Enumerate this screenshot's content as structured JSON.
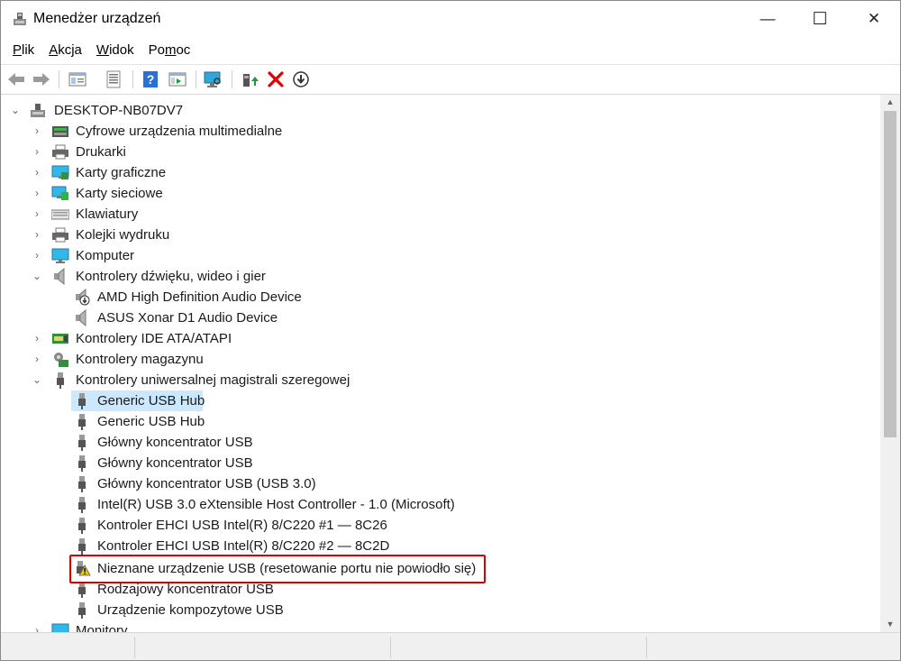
{
  "window": {
    "title": "Menedżer urządzeń",
    "app_icon": "device-manager-icon",
    "controls": {
      "minimize": "—",
      "maximize": "☐",
      "close": "✕"
    }
  },
  "menubar": {
    "items": [
      {
        "label": "Plik",
        "underline": "P"
      },
      {
        "label": "Akcja",
        "underline": "A"
      },
      {
        "label": "Widok",
        "underline": "W"
      },
      {
        "label": "Pomoc",
        "underline": "m"
      }
    ]
  },
  "toolbar": {
    "buttons": [
      "back-arrow-icon",
      "forward-arrow-icon",
      "properties-pane-icon",
      "device-list-icon",
      "help-icon",
      "show-hide-tree-icon",
      "scan-hardware-icon",
      "update-driver-icon",
      "uninstall-x-icon",
      "disable-device-icon"
    ],
    "colors": {
      "help": "#2a6fd6",
      "uninstall": "#e00000",
      "update": "#1a9b3a"
    }
  },
  "tree": {
    "root": "DESKTOP-NB07DV7",
    "nodes": [
      {
        "label": "Cyfrowe urządzenia multimedialne",
        "icon": "multimedia-device-icon",
        "expanded": false
      },
      {
        "label": "Drukarki",
        "icon": "printer-icon",
        "expanded": false
      },
      {
        "label": "Karty graficzne",
        "icon": "display-adapter-icon",
        "expanded": false
      },
      {
        "label": "Karty sieciowe",
        "icon": "network-adapter-icon",
        "expanded": false
      },
      {
        "label": "Klawiatury",
        "icon": "keyboard-icon",
        "expanded": false
      },
      {
        "label": "Kolejki wydruku",
        "icon": "print-queue-icon",
        "expanded": false
      },
      {
        "label": "Komputer",
        "icon": "computer-icon",
        "expanded": false
      },
      {
        "label": "Kontrolery dźwięku, wideo i gier",
        "icon": "speaker-icon",
        "expanded": true,
        "children": [
          {
            "label": "AMD High Definition Audio Device",
            "icon": "audio-device-disabled-icon"
          },
          {
            "label": "ASUS Xonar D1 Audio Device",
            "icon": "speaker-icon"
          }
        ]
      },
      {
        "label": "Kontrolery IDE ATA/ATAPI",
        "icon": "ide-controller-icon",
        "expanded": false
      },
      {
        "label": "Kontrolery magazynu",
        "icon": "storage-controller-icon",
        "expanded": false
      },
      {
        "label": "Kontrolery uniwersalnej magistrali szeregowej",
        "icon": "usb-plug-icon",
        "expanded": true,
        "children": [
          {
            "label": "Generic USB Hub",
            "icon": "usb-plug-icon",
            "selected": true
          },
          {
            "label": "Generic USB Hub",
            "icon": "usb-plug-icon"
          },
          {
            "label": "Główny koncentrator USB",
            "icon": "usb-plug-icon"
          },
          {
            "label": "Główny koncentrator USB",
            "icon": "usb-plug-icon"
          },
          {
            "label": "Główny koncentrator USB (USB 3.0)",
            "icon": "usb-plug-icon"
          },
          {
            "label": "Intel(R) USB 3.0 eXtensible Host Controller - 1.0 (Microsoft)",
            "icon": "usb-plug-icon"
          },
          {
            "label": "Kontroler EHCI USB Intel(R) 8/C220 #1 — 8C26",
            "icon": "usb-plug-icon"
          },
          {
            "label": "Kontroler EHCI USB Intel(R) 8/C220 #2 — 8C2D",
            "icon": "usb-plug-icon"
          },
          {
            "label": "Nieznane urządzenie USB (resetowanie portu nie powiodło się)",
            "icon": "usb-warning-icon",
            "warning": true
          },
          {
            "label": "Rodzajowy koncentrator USB",
            "icon": "usb-plug-icon"
          },
          {
            "label": "Urządzenie kompozytowe USB",
            "icon": "usb-plug-icon"
          }
        ]
      },
      {
        "label": "Monitory",
        "icon": "monitor-icon",
        "expanded": false
      }
    ]
  },
  "colors": {
    "selection": "#cce8ff",
    "highlight_border": "#d90000"
  }
}
